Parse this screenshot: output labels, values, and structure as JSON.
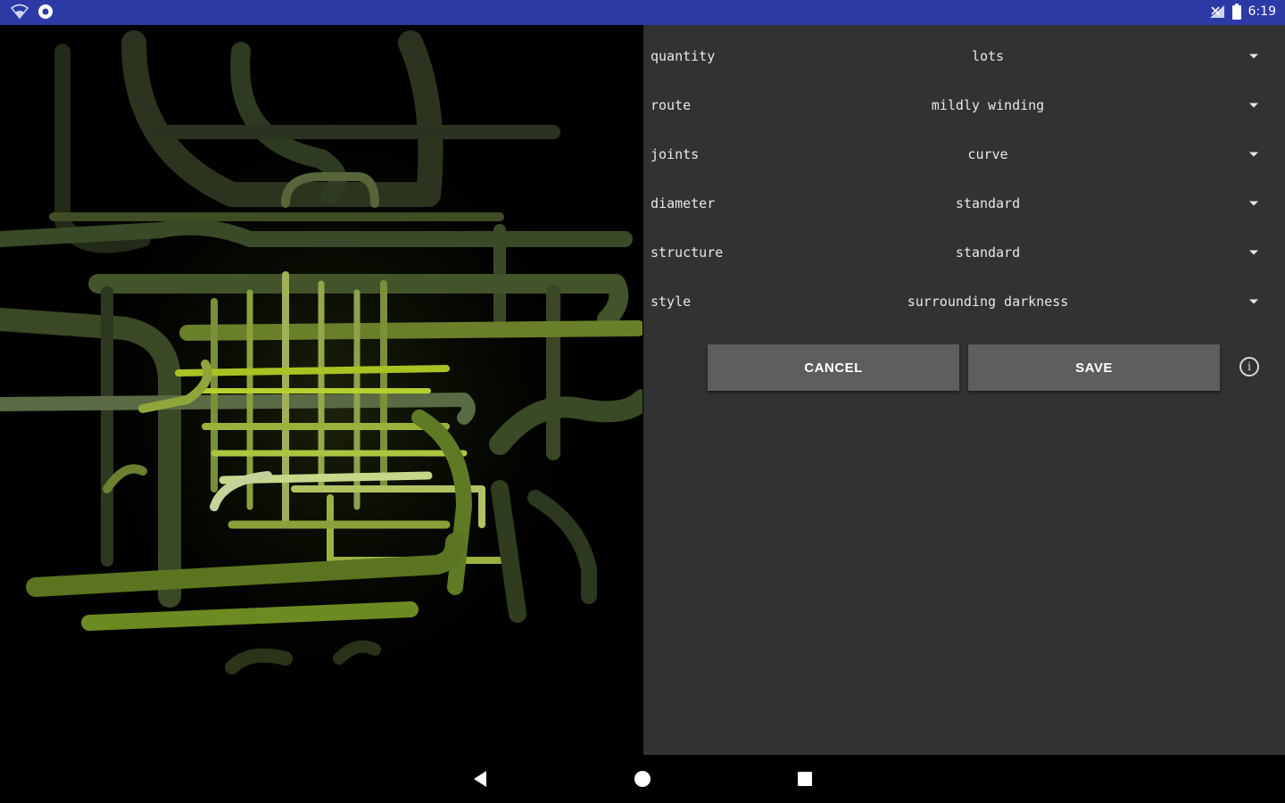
{
  "status_bar": {
    "time": "6:19",
    "left_icons": [
      "wifi-icon",
      "notification-icon"
    ],
    "right_icons": [
      "signal-icon",
      "battery-icon"
    ],
    "background": "#2d3aa6"
  },
  "preview": {
    "description_icon": "pipes-3d-preview"
  },
  "settings": {
    "rows": [
      {
        "label": "quantity",
        "value": "lots"
      },
      {
        "label": "route",
        "value": "mildly winding"
      },
      {
        "label": "joints",
        "value": "curve"
      },
      {
        "label": "diameter",
        "value": "standard"
      },
      {
        "label": "structure",
        "value": "standard"
      },
      {
        "label": "style",
        "value": "surrounding darkness"
      }
    ],
    "cancel_label": "CANCEL",
    "save_label": "SAVE",
    "info_icon": "info-icon"
  },
  "nav_bar": {
    "icons": [
      "back-icon",
      "home-icon",
      "recents-icon"
    ]
  },
  "colors": {
    "panel": "#323232",
    "button": "#5e5e5e",
    "pipe_bright": "#9fc21a",
    "pipe_dark": "#3b4a26"
  }
}
